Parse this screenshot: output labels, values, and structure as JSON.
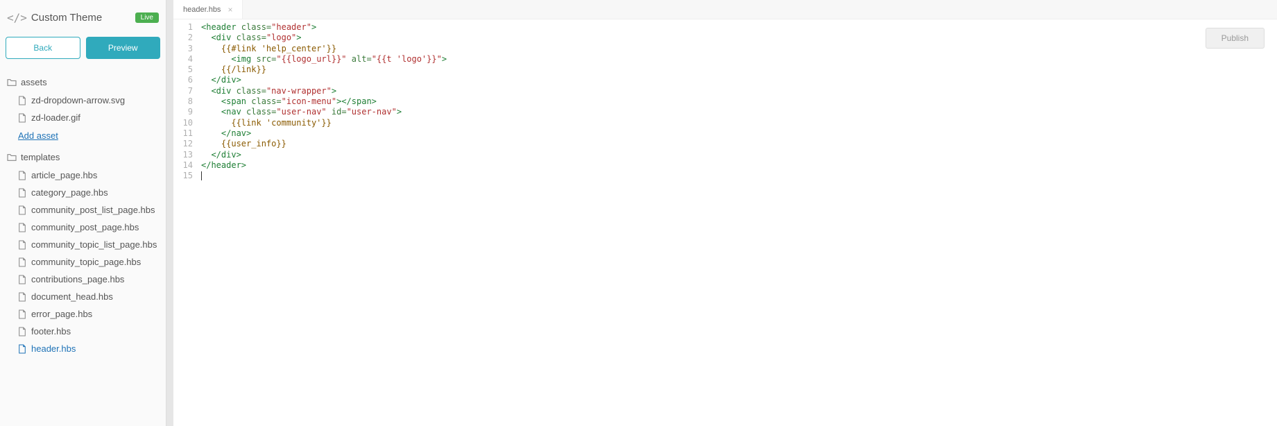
{
  "header": {
    "title": "Custom Theme",
    "badge": "Live"
  },
  "buttons": {
    "back": "Back",
    "preview": "Preview",
    "publish": "Publish"
  },
  "sections": {
    "assets": {
      "label": "assets",
      "files": [
        "zd-dropdown-arrow.svg",
        "zd-loader.gif"
      ],
      "add_link": "Add asset"
    },
    "templates": {
      "label": "templates",
      "files": [
        "article_page.hbs",
        "category_page.hbs",
        "community_post_list_page.hbs",
        "community_post_page.hbs",
        "community_topic_list_page.hbs",
        "community_topic_page.hbs",
        "contributions_page.hbs",
        "document_head.hbs",
        "error_page.hbs",
        "footer.hbs",
        "header.hbs"
      ],
      "active": "header.hbs"
    }
  },
  "tab": {
    "label": "header.hbs"
  },
  "code": {
    "total_lines": 15,
    "lines": [
      {
        "n": 1,
        "indent": 0,
        "tokens": [
          {
            "t": "tag",
            "v": "<header "
          },
          {
            "t": "attr",
            "v": "class="
          },
          {
            "t": "val",
            "v": "\"header\""
          },
          {
            "t": "tag",
            "v": ">"
          }
        ]
      },
      {
        "n": 2,
        "indent": 1,
        "tokens": [
          {
            "t": "tag",
            "v": "<div "
          },
          {
            "t": "attr",
            "v": "class="
          },
          {
            "t": "val",
            "v": "\"logo\""
          },
          {
            "t": "tag",
            "v": ">"
          }
        ]
      },
      {
        "n": 3,
        "indent": 2,
        "tokens": [
          {
            "t": "hbs",
            "v": "{{#link 'help_center'}}"
          }
        ]
      },
      {
        "n": 4,
        "indent": 3,
        "tokens": [
          {
            "t": "tag",
            "v": "<img "
          },
          {
            "t": "attr",
            "v": "src="
          },
          {
            "t": "val",
            "v": "\"{{logo_url}}\""
          },
          {
            "t": "plain",
            "v": " "
          },
          {
            "t": "attr",
            "v": "alt="
          },
          {
            "t": "val",
            "v": "\"{{t 'logo'}}\""
          },
          {
            "t": "tag",
            "v": ">"
          }
        ]
      },
      {
        "n": 5,
        "indent": 2,
        "tokens": [
          {
            "t": "hbs",
            "v": "{{/link}}"
          }
        ]
      },
      {
        "n": 6,
        "indent": 1,
        "tokens": [
          {
            "t": "tag",
            "v": "</div>"
          }
        ]
      },
      {
        "n": 7,
        "indent": 1,
        "tokens": [
          {
            "t": "tag",
            "v": "<div "
          },
          {
            "t": "attr",
            "v": "class="
          },
          {
            "t": "val",
            "v": "\"nav-wrapper\""
          },
          {
            "t": "tag",
            "v": ">"
          }
        ]
      },
      {
        "n": 8,
        "indent": 2,
        "tokens": [
          {
            "t": "tag",
            "v": "<span "
          },
          {
            "t": "attr",
            "v": "class="
          },
          {
            "t": "val",
            "v": "\"icon-menu\""
          },
          {
            "t": "tag",
            "v": "></span>"
          }
        ]
      },
      {
        "n": 9,
        "indent": 2,
        "tokens": [
          {
            "t": "tag",
            "v": "<nav "
          },
          {
            "t": "attr",
            "v": "class="
          },
          {
            "t": "val",
            "v": "\"user-nav\""
          },
          {
            "t": "plain",
            "v": " "
          },
          {
            "t": "attr",
            "v": "id="
          },
          {
            "t": "val",
            "v": "\"user-nav\""
          },
          {
            "t": "tag",
            "v": ">"
          }
        ]
      },
      {
        "n": 10,
        "indent": 3,
        "tokens": [
          {
            "t": "hbs",
            "v": "{{link 'community'}}"
          }
        ]
      },
      {
        "n": 11,
        "indent": 2,
        "tokens": [
          {
            "t": "tag",
            "v": "</nav>"
          }
        ]
      },
      {
        "n": 12,
        "indent": 2,
        "tokens": [
          {
            "t": "hbs",
            "v": "{{user_info}}"
          }
        ]
      },
      {
        "n": 13,
        "indent": 1,
        "tokens": [
          {
            "t": "tag",
            "v": "</div>"
          }
        ]
      },
      {
        "n": 14,
        "indent": 0,
        "tokens": [
          {
            "t": "tag",
            "v": "</header>"
          }
        ]
      },
      {
        "n": 15,
        "indent": 0,
        "tokens": [],
        "cursor": true
      }
    ]
  }
}
